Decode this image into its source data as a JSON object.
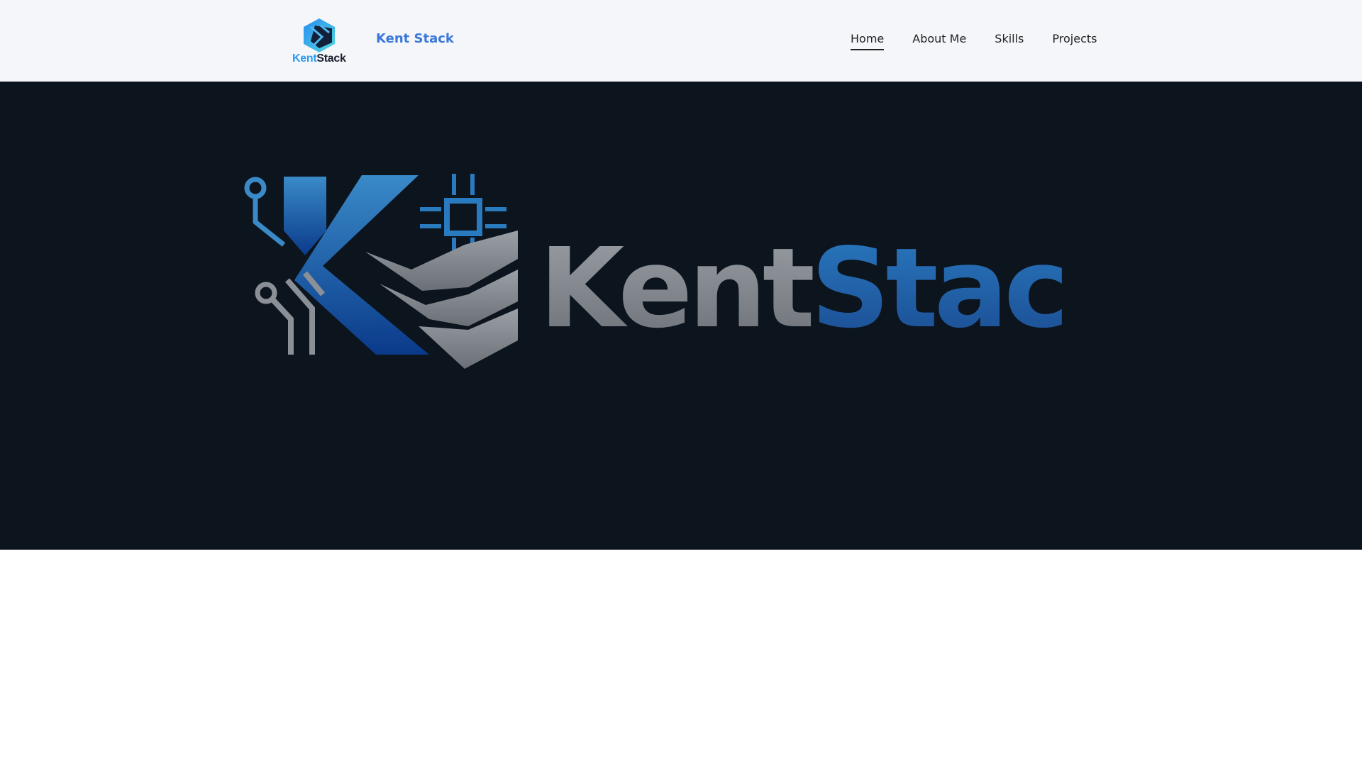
{
  "header": {
    "logo_text_part1": "Kent",
    "logo_text_part2": "Stack",
    "site_title": "Kent Stack",
    "nav": [
      {
        "label": "Home",
        "active": true
      },
      {
        "label": "About Me"
      },
      {
        "label": "Skills"
      },
      {
        "label": "Projects"
      }
    ]
  },
  "hero": {
    "logo_word1": "Kent",
    "logo_word2": "Stack"
  },
  "colors": {
    "accent": "#3a78db",
    "hero_bg": "#0c141e",
    "header_bg": "#f5f6fa"
  }
}
